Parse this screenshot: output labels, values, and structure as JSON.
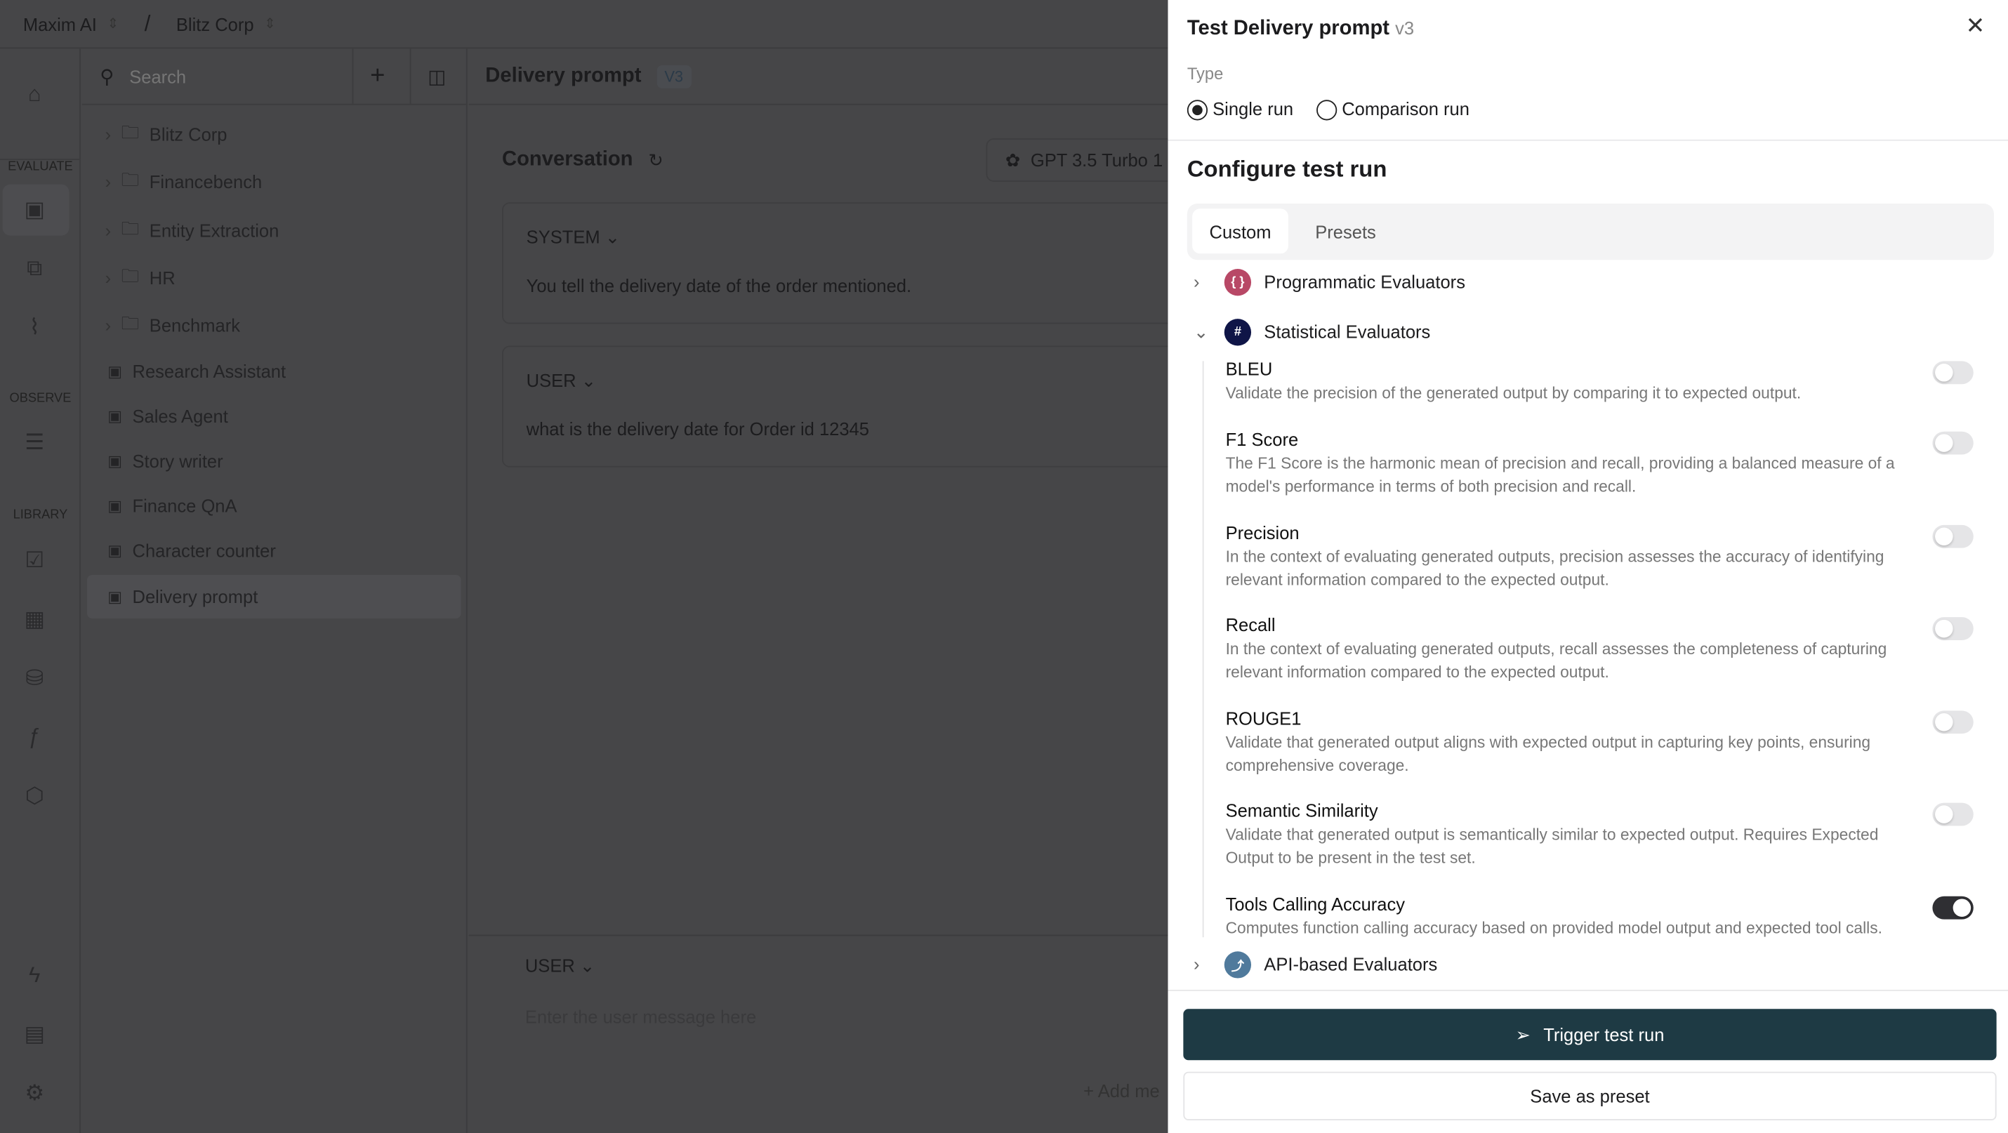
{
  "topbar": {
    "org": "Maxim AI",
    "separator": "/",
    "workspace": "Blitz Corp"
  },
  "rail": {
    "sections": [
      "EVALUATE",
      "OBSERVE",
      "LIBRARY"
    ]
  },
  "tree": {
    "search_placeholder": "Search",
    "folders": [
      "Blitz Corp",
      "Financebench",
      "Entity Extraction",
      "HR",
      "Benchmark"
    ],
    "prompts": [
      "Research Assistant",
      "Sales Agent",
      "Story writer",
      "Finance QnA",
      "Character counter",
      "Delivery prompt"
    ],
    "selected": "Delivery prompt"
  },
  "main": {
    "title": "Delivery prompt",
    "version": "V3",
    "conversation_label": "Conversation",
    "model": "GPT 3.5 Turbo 1",
    "system_label": "SYSTEM",
    "system_text": "You tell the delivery date of the  order mentioned.",
    "user_label": "USER",
    "user_text": "what is the delivery date for Order id 12345",
    "input_label": "USER",
    "input_placeholder": "Enter the user message here",
    "add_message": "Add me"
  },
  "panel": {
    "title": "Test Delivery prompt",
    "version": "v3",
    "type_label": "Type",
    "types": [
      {
        "label": "Single run",
        "selected": true
      },
      {
        "label": "Comparison run",
        "selected": false
      }
    ],
    "configure_title": "Configure test run",
    "tabs": [
      {
        "label": "Custom",
        "active": true
      },
      {
        "label": "Presets",
        "active": false
      }
    ],
    "groups": [
      {
        "label": "Programmatic Evaluators",
        "expanded": false,
        "color": "#b84866",
        "icon": "curly-braces-icon"
      },
      {
        "label": "Statistical Evaluators",
        "expanded": true,
        "color": "#0f1547",
        "icon": "hash-icon"
      },
      {
        "label": "API-based Evaluators",
        "expanded": false,
        "color": "#507a9c",
        "icon": "route-icon"
      }
    ],
    "evaluators": [
      {
        "name": "BLEU",
        "desc": "Validate the precision of the generated output by comparing it to expected output.",
        "enabled": false
      },
      {
        "name": "F1 Score",
        "desc": "The F1 Score is the harmonic mean of precision and recall, providing a balanced measure of a model's performance in terms of both precision and recall.",
        "enabled": false
      },
      {
        "name": "Precision",
        "desc": "In the context of evaluating generated outputs, precision assesses the accuracy of identifying relevant information compared to the expected output.",
        "enabled": false
      },
      {
        "name": "Recall",
        "desc": "In the context of evaluating generated outputs, recall assesses the completeness of capturing relevant information compared to the expected output.",
        "enabled": false
      },
      {
        "name": "ROUGE1",
        "desc": "Validate that generated output aligns with expected output in capturing key points, ensuring comprehensive coverage.",
        "enabled": false
      },
      {
        "name": "Semantic Similarity",
        "desc": "Validate that generated output is semantically similar to expected output. Requires Expected Output to be present in the test set.",
        "enabled": false
      },
      {
        "name": "Tools Calling Accuracy",
        "desc": "Computes function calling accuracy based on provided model output and expected tool calls.",
        "enabled": true
      }
    ],
    "trigger_label": "Trigger test run",
    "save_label": "Save as preset",
    "trigger_color": "#1e3a44"
  }
}
